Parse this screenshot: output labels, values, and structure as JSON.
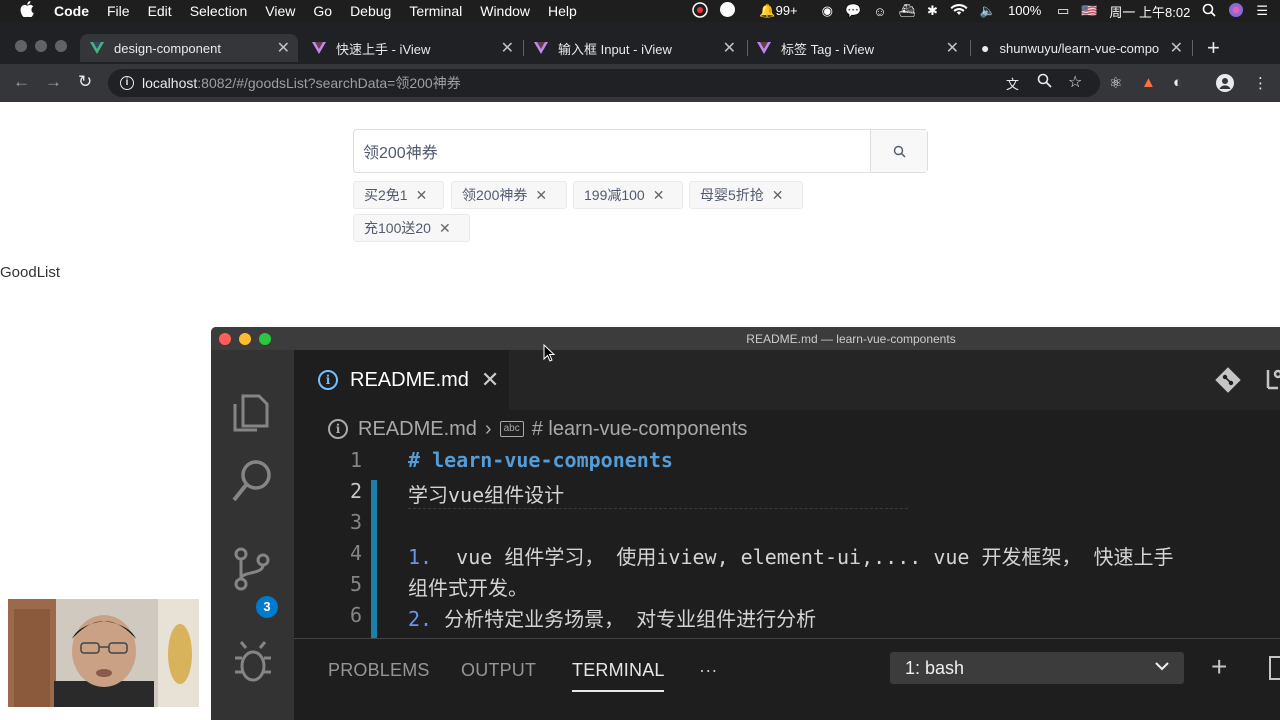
{
  "menubar": {
    "app": "Code",
    "items": [
      "File",
      "Edit",
      "Selection",
      "View",
      "Go",
      "Debug",
      "Terminal",
      "Window",
      "Help"
    ],
    "notification_count": "99+",
    "battery": "100%",
    "clock": "周一 上午8:02"
  },
  "browser": {
    "tabs": [
      {
        "label": "design-component"
      },
      {
        "label": "快速上手 - iView"
      },
      {
        "label": "输入框 Input - iView"
      },
      {
        "label": "标签 Tag - iView"
      },
      {
        "label": "shunwuyu/learn-vue-compo"
      }
    ],
    "url_host": "localhost",
    "url_rest": ":8082/#/goodsList?searchData=领200神券"
  },
  "page": {
    "search_value": "领200神券",
    "tags": [
      "买2免1",
      "领200神券",
      "199减100",
      "母婴5折抢",
      "充100送20"
    ],
    "goodlist_label": "GoodList"
  },
  "vscode": {
    "window_title": "README.md — learn-vue-components",
    "badge_count": "3",
    "editor_tab": "README.md",
    "breadcrumb": {
      "file": "README.md",
      "symbol": "# learn-vue-components",
      "symbol_icon": "abc"
    },
    "lines": [
      {
        "n": "1",
        "text": "# learn-vue-components"
      },
      {
        "n": "2",
        "text": "学习vue组件设计"
      },
      {
        "n": "3",
        "text": ""
      },
      {
        "n": "4",
        "num": "1.",
        "text": "  vue 组件学习， 使用iview, element-ui,.... vue 开发框架， 快速上手"
      },
      {
        "n": "5",
        "text": "组件式开发。"
      },
      {
        "n": "6",
        "num": "2.",
        "text": " 分析特定业务场景， 对专业组件进行分析"
      }
    ],
    "panel_tabs": [
      "PROBLEMS",
      "OUTPUT",
      "TERMINAL"
    ],
    "panel_more": "···",
    "terminal_select": "1: bash"
  }
}
